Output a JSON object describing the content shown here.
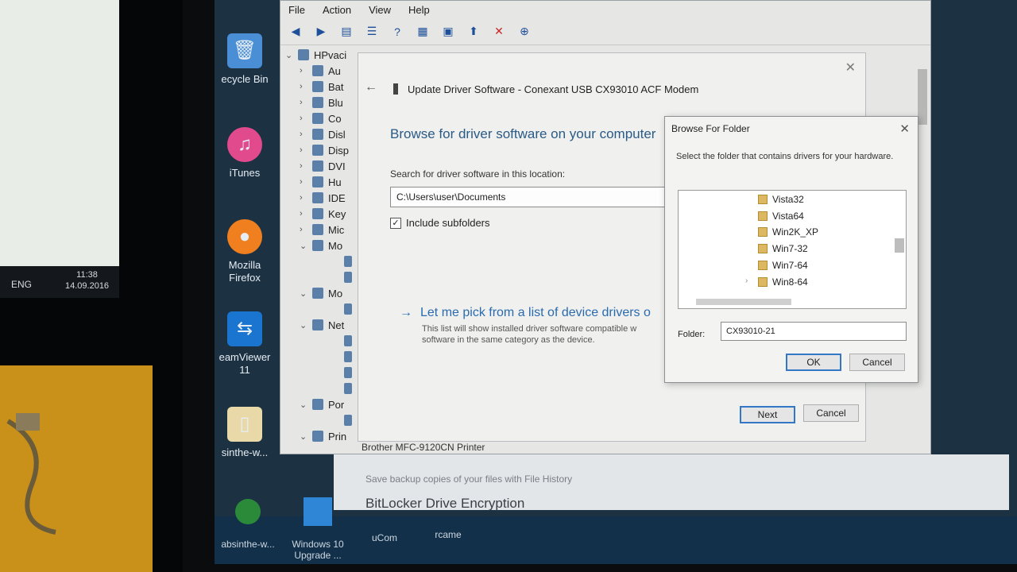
{
  "left_screen": {
    "lang": "ENG",
    "time": "11:38",
    "date": "14.09.2016"
  },
  "desktop_icons": [
    {
      "label": "ecycle Bin",
      "icon": "recycle-bin-icon",
      "color": "#4a8fd6"
    },
    {
      "label": "iTunes",
      "icon": "itunes-icon",
      "color": "#e24a8e"
    },
    {
      "label": "Mozilla Firefox",
      "icon": "firefox-icon",
      "color": "#f0801f"
    },
    {
      "label": "eamViewer 11",
      "icon": "teamviewer-icon",
      "color": "#1a75d1"
    },
    {
      "label": "sinthe-w...",
      "icon": "file-icon",
      "color": "#e9d9a8"
    }
  ],
  "device_manager": {
    "menu": [
      "File",
      "Action",
      "View",
      "Help"
    ],
    "tree": [
      {
        "label": "HPvaci",
        "expanded": true
      },
      {
        "label": "Au",
        "expanded": false
      },
      {
        "label": "Bat",
        "expanded": false
      },
      {
        "label": "Blu",
        "expanded": false
      },
      {
        "label": "Co",
        "expanded": false
      },
      {
        "label": "Disl",
        "expanded": false
      },
      {
        "label": "Disp",
        "expanded": false
      },
      {
        "label": "DVI",
        "expanded": false
      },
      {
        "label": "Hu",
        "expanded": false
      },
      {
        "label": "IDE",
        "expanded": false
      },
      {
        "label": "Key",
        "expanded": false
      },
      {
        "label": "Mic",
        "expanded": false
      },
      {
        "label": "Mo",
        "expanded": true
      },
      {
        "label": "",
        "expanded": null
      },
      {
        "label": "",
        "expanded": null
      },
      {
        "label": "Mo",
        "expanded": true
      },
      {
        "label": "",
        "expanded": null
      },
      {
        "label": "Net",
        "expanded": true
      },
      {
        "label": "",
        "expanded": null
      },
      {
        "label": "",
        "expanded": null
      },
      {
        "label": "",
        "expanded": null
      },
      {
        "label": "",
        "expanded": null
      },
      {
        "label": "Por",
        "expanded": true
      },
      {
        "label": "",
        "expanded": null
      },
      {
        "label": "Prin",
        "expanded": true
      }
    ],
    "printer_item": "Brother MFC-9120CN Printer"
  },
  "update_dialog": {
    "title": "Update Driver Software - Conexant USB CX93010 ACF Modem",
    "heading": "Browse for driver software on your computer",
    "search_label": "Search for driver software in this location:",
    "path": "C:\\Users\\user\\Documents",
    "include_subfolders": "Include subfolders",
    "pick_link": "Let me pick from a list of device drivers o",
    "pick_desc": "This list will show installed driver software compatible w software in the same category as the device.",
    "next": "Next",
    "cancel": "Cancel"
  },
  "browse_dialog": {
    "title": "Browse For Folder",
    "instruction": "Select the folder that contains drivers for your hardware.",
    "folders": [
      "Vista32",
      "Vista64",
      "Win2K_XP",
      "Win7-32",
      "Win7-64",
      "Win8-64"
    ],
    "folder_label": "Folder:",
    "folder_value": "CX93010-21",
    "ok": "OK",
    "cancel": "Cancel"
  },
  "control_panel": {
    "line1": "Save backup copies of your files with File History",
    "line2": "BitLocker Drive Encryption"
  },
  "taskbar": {
    "items": [
      {
        "label": "absinthe-w...",
        "icon": "absinthe-icon"
      },
      {
        "label": "Windows 10 Upgrade ...",
        "icon": "windows-icon"
      },
      {
        "label": "uCom",
        "icon": "app-icon"
      },
      {
        "label": "rcame",
        "icon": "app-icon"
      }
    ]
  }
}
